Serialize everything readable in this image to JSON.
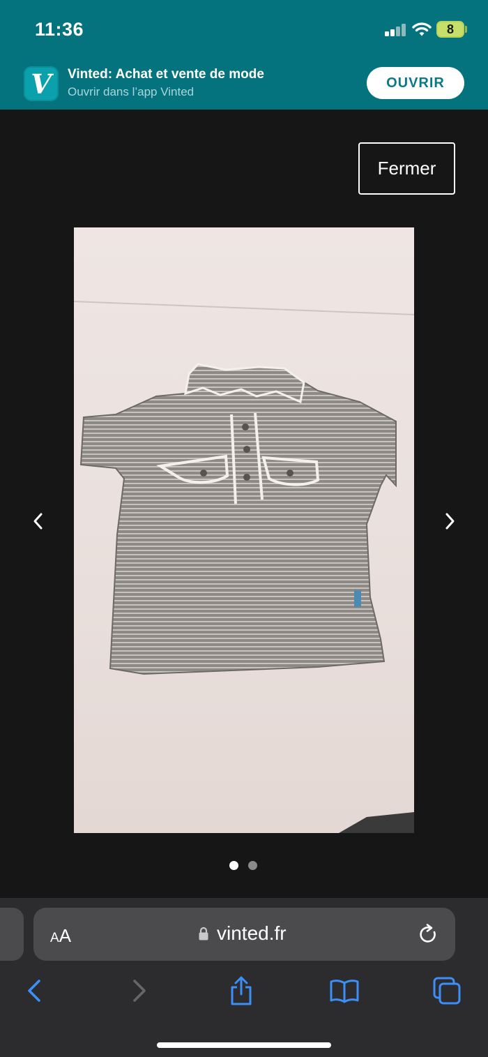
{
  "status_bar": {
    "time": "11:36",
    "battery": "8"
  },
  "smart_banner": {
    "app_icon_letter": "V",
    "title": "Vinted: Achat et vente de mode",
    "subtitle": "Ouvrir dans l’app Vinted",
    "open_label": "OUVRIR"
  },
  "viewer": {
    "close_label": "Fermer",
    "photo_count": 2,
    "active_index": 1
  },
  "browser": {
    "text_size_label_small": "A",
    "text_size_label_big": "A",
    "url": "vinted.fr"
  },
  "colors": {
    "banner_bg": "#05737d",
    "viewer_bg": "#161616",
    "browser_chrome": "#2c2c2e",
    "toolbar_blue": "#3d8ef7"
  },
  "icons": [
    "signal-icon",
    "wifi-icon",
    "battery-icon",
    "lock-icon",
    "reload-icon",
    "back-icon",
    "forward-icon",
    "share-icon",
    "bookmarks-icon",
    "tabs-icon",
    "chevron-left-icon",
    "chevron-right-icon"
  ]
}
